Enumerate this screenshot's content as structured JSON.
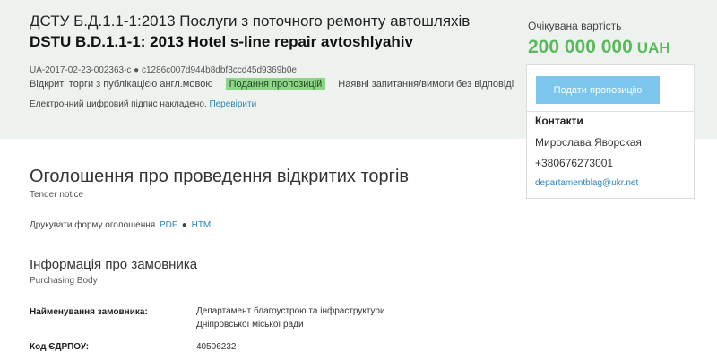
{
  "tender": {
    "title_ua": "ДСТУ Б.Д.1.1-1:2013 Послуги з поточного ремонту автошляхів",
    "title_en": "DSTU B.D.1.1-1: 2013 Hotel s-line repair avtoshlyahiv",
    "id_line": "UA-2017-02-23-002363-c ● c1286c007d944b8dbf3ccd45d9369b0e",
    "procedure": "Відкриті торги з публікацією англ.мовою",
    "status_badge": "Подання пропозицій",
    "questions": "Наявні запитання/вимоги без відповіді",
    "signature_text": "Електронний цифровий підпис накладено.",
    "signature_link": "Перевірити"
  },
  "expected": {
    "label": "Очікувана вартість",
    "amount": "200 000 000",
    "currency": "UAH"
  },
  "sidebar": {
    "submit_label": "Подати пропозицію",
    "contacts_title": "Контакти",
    "contact_name": "Мирослава Яворская",
    "contact_phone": "+380676273001",
    "contact_email": "departamentblag@ukr.net"
  },
  "notice": {
    "title": "Оголошення про проведення відкритих торгів",
    "subtitle": "Tender notice",
    "print_label": "Друкувати форму оголошення",
    "print_pdf": "PDF",
    "print_sep": "●",
    "print_html": "HTML"
  },
  "buyer": {
    "title": "Інформація про замовника",
    "subtitle": "Purchasing Body",
    "name_label": "Найменування замовника:",
    "name_value_line1": "Департамент благоустрою та інфраструктури",
    "name_value_line2": "Дніпровської міської ради",
    "code_label": "Код ЄДРПОУ:",
    "code_value": "40506232"
  },
  "colors": {
    "header_bg": "#eef2ef",
    "accent_green": "#5cb85c",
    "badge_green": "#8fd48b",
    "button_blue": "#7cc5ec",
    "link_blue": "#2f84b5"
  }
}
